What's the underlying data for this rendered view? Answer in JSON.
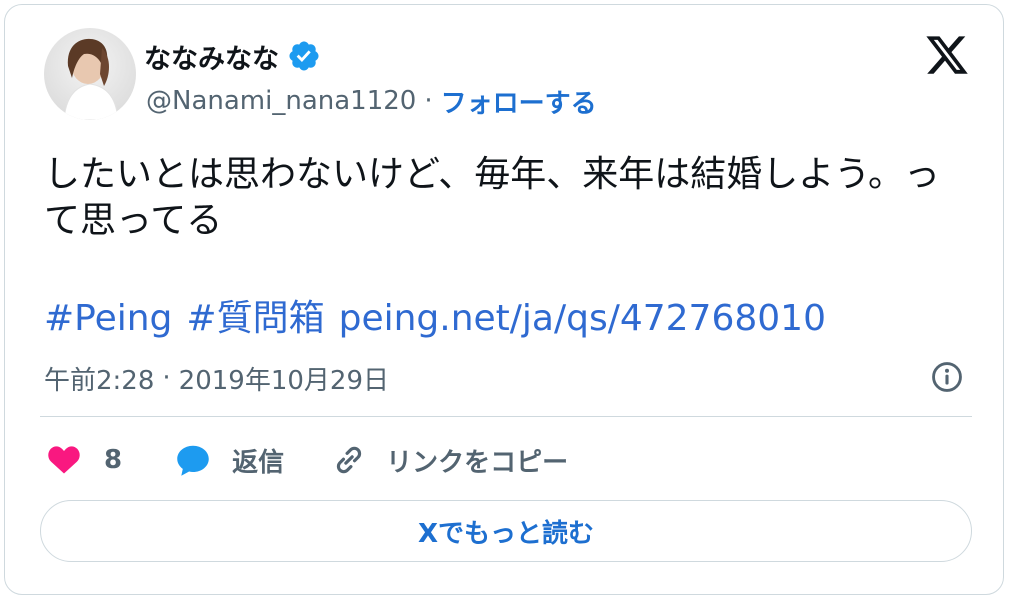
{
  "author": {
    "display_name": "ななみなな",
    "handle": "@Nanami_nana1120",
    "verified_icon": "verified-badge-icon",
    "follow_label": "フォローする"
  },
  "tweet": {
    "text": "したいとは思わないけど、毎年、来年は結婚しよう。って思ってる",
    "hashtag1": "#Peing",
    "hashtag2": "#質問箱",
    "link": "peing.net/ja/qs/472768010",
    "time": "午前2:28",
    "separator": "·",
    "date": "2019年10月29日"
  },
  "actions": {
    "like_count": "8",
    "reply_label": "返信",
    "copy_link_label": "リンクをコピー"
  },
  "read_more_label": "Xでもっと読む",
  "colors": {
    "accent": "#1d6fd0",
    "link": "#2f6ad1",
    "like": "#f91880",
    "reply": "#1d9bf0",
    "muted": "#536471",
    "border": "#cfd9de"
  }
}
